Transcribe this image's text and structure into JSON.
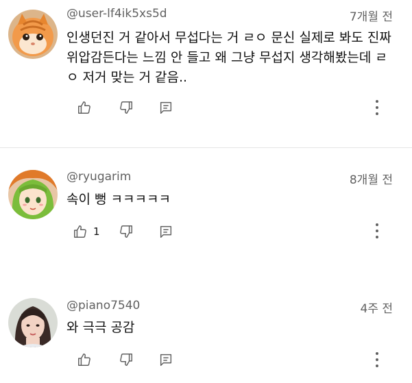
{
  "comments": [
    {
      "author": "@user-lf4ik5xs5d",
      "time": "7개월 전",
      "text": "인생던진 거 같아서 무섭다는 거 ㄹㅇ 문신 실제로 봐도 진짜 위압감든다는 느낌 안 들고 왜 그냥 무섭지 생각해봤는데 ㄹㅇ 저거 맞는 거 같음..",
      "likes": "",
      "avatar": "orange-cat-avatar"
    },
    {
      "author": "@ryugarim",
      "time": "8개월 전",
      "text": "속이 뻥 ㅋㅋㅋㅋㅋ",
      "likes": "1",
      "avatar": "anime-girl-avatar"
    },
    {
      "author": "@piano7540",
      "time": "4주 전",
      "text": "와 극극 공감",
      "likes": "",
      "avatar": "photo-avatar"
    }
  ],
  "icons": {
    "like": "thumbs-up-icon",
    "dislike": "thumbs-down-icon",
    "reply": "reply-icon",
    "more": "more-vert-icon"
  },
  "colors": {
    "meta_text": "#606060",
    "body_text": "#0f0f0f",
    "divider": "#e5e5e5"
  }
}
